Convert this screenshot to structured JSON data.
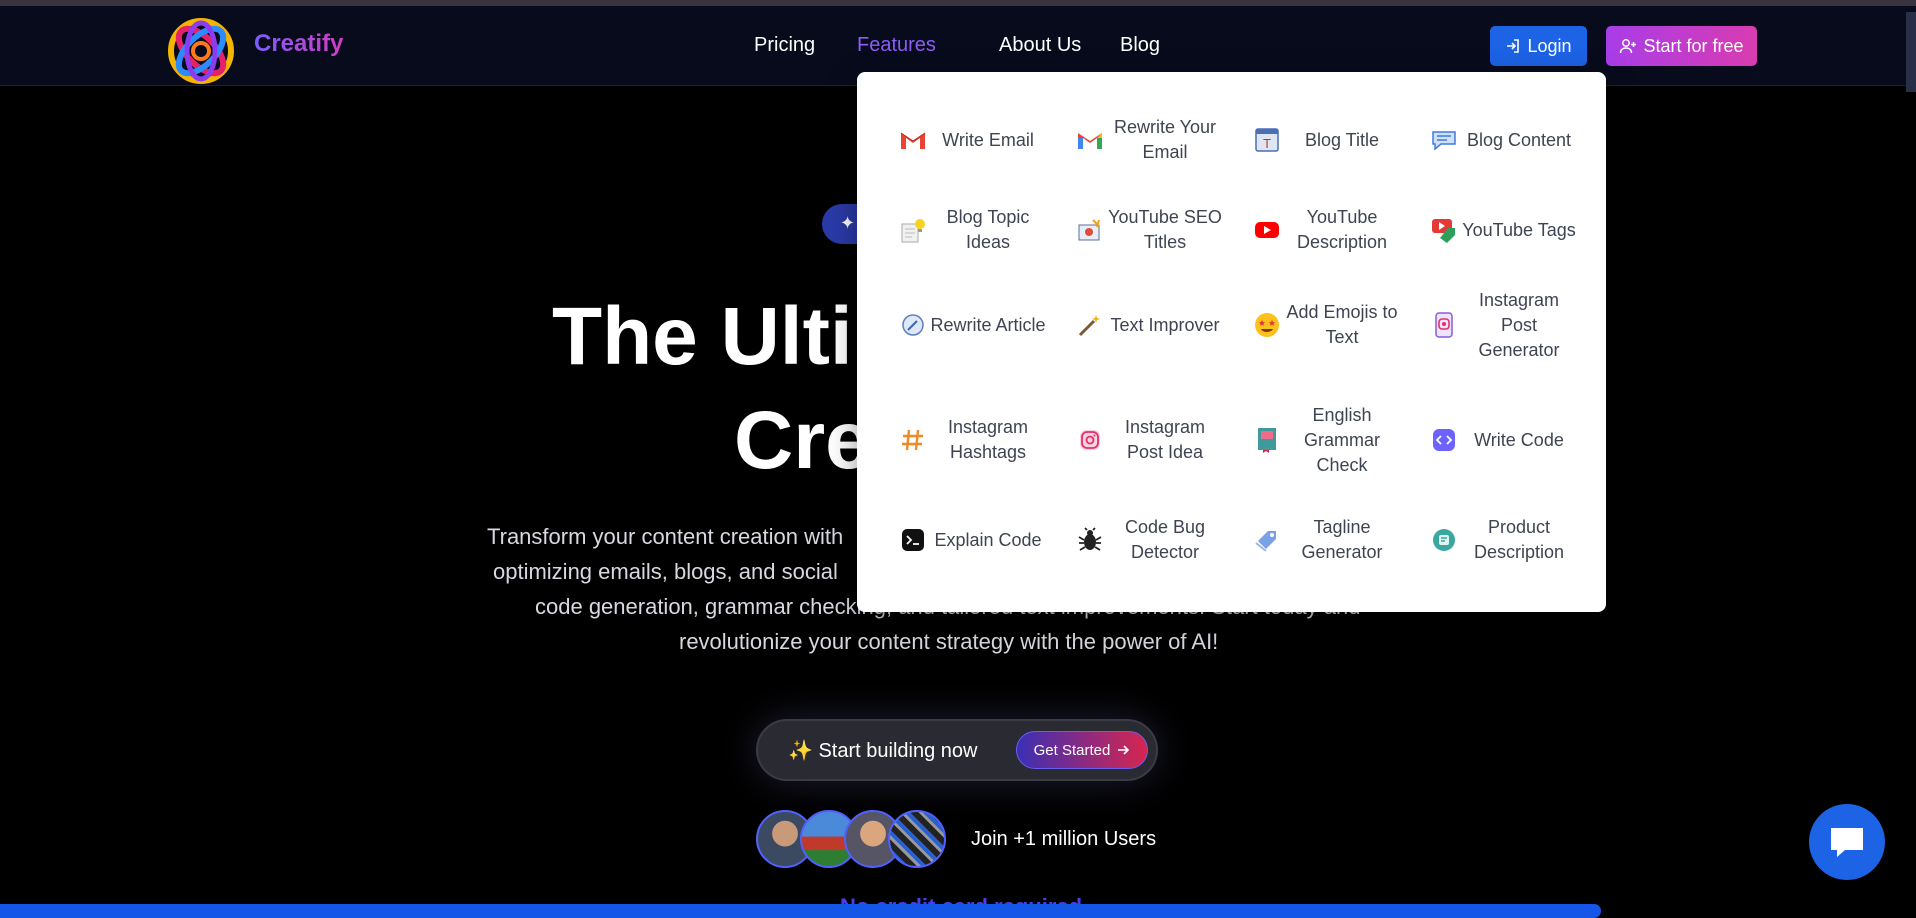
{
  "brand": {
    "name": "Creatify"
  },
  "nav": {
    "pricing": "Pricing",
    "features": "Features",
    "about": "About Us",
    "blog": "Blog",
    "login": "Login",
    "start_free": "Start for free"
  },
  "hero": {
    "title_line1": "The Ultim",
    "title_line2": "Crea",
    "desc_line1": "Transform your content creation with",
    "desc_line2": "optimizing emails, blogs, and social",
    "desc_line3": "code generation, grammar checking, and tailored text improvements. Start today and",
    "desc_line4": "revolutionize your content strategy with the power of AI!",
    "cta_text": "✨ Start building now",
    "cta_button": "Get Started",
    "join_text": "Join +1 million Users",
    "bottom_text": "No credit card required"
  },
  "features_menu": {
    "items": [
      {
        "label": "Write Email",
        "icon": "gmail-icon"
      },
      {
        "label": "Rewrite Your Email",
        "icon": "gmail-icon"
      },
      {
        "label": "Blog Title",
        "icon": "blog-title-icon"
      },
      {
        "label": "Blog Content",
        "icon": "blog-content-icon"
      },
      {
        "label": "Blog Topic Ideas",
        "icon": "lightbulb-note-icon"
      },
      {
        "label": "YouTube SEO Titles",
        "icon": "seo-icon"
      },
      {
        "label": "YouTube Description",
        "icon": "youtube-icon"
      },
      {
        "label": "YouTube Tags",
        "icon": "youtube-tag-icon"
      },
      {
        "label": "Rewrite Article",
        "icon": "rewrite-icon"
      },
      {
        "label": "Text Improver",
        "icon": "magic-wand-icon"
      },
      {
        "label": "Add Emojis to Text",
        "icon": "star-eyes-emoji-icon"
      },
      {
        "label": "Instagram Post Generator",
        "icon": "instagram-phone-icon"
      },
      {
        "label": "Instagram Hashtags",
        "icon": "hashtag-icon"
      },
      {
        "label": "Instagram Post Idea",
        "icon": "instagram-icon"
      },
      {
        "label": "English Grammar Check",
        "icon": "grammar-book-icon"
      },
      {
        "label": "Write Code",
        "icon": "code-icon"
      },
      {
        "label": "Explain Code",
        "icon": "terminal-icon"
      },
      {
        "label": "Code Bug Detector",
        "icon": "bug-icon"
      },
      {
        "label": "Tagline Generator",
        "icon": "tag-icon"
      },
      {
        "label": "Product Description",
        "icon": "product-icon"
      }
    ]
  },
  "colors": {
    "accent_blue": "#1d63e6",
    "accent_purple": "#a83de8",
    "accent_pink": "#d93cb0"
  }
}
